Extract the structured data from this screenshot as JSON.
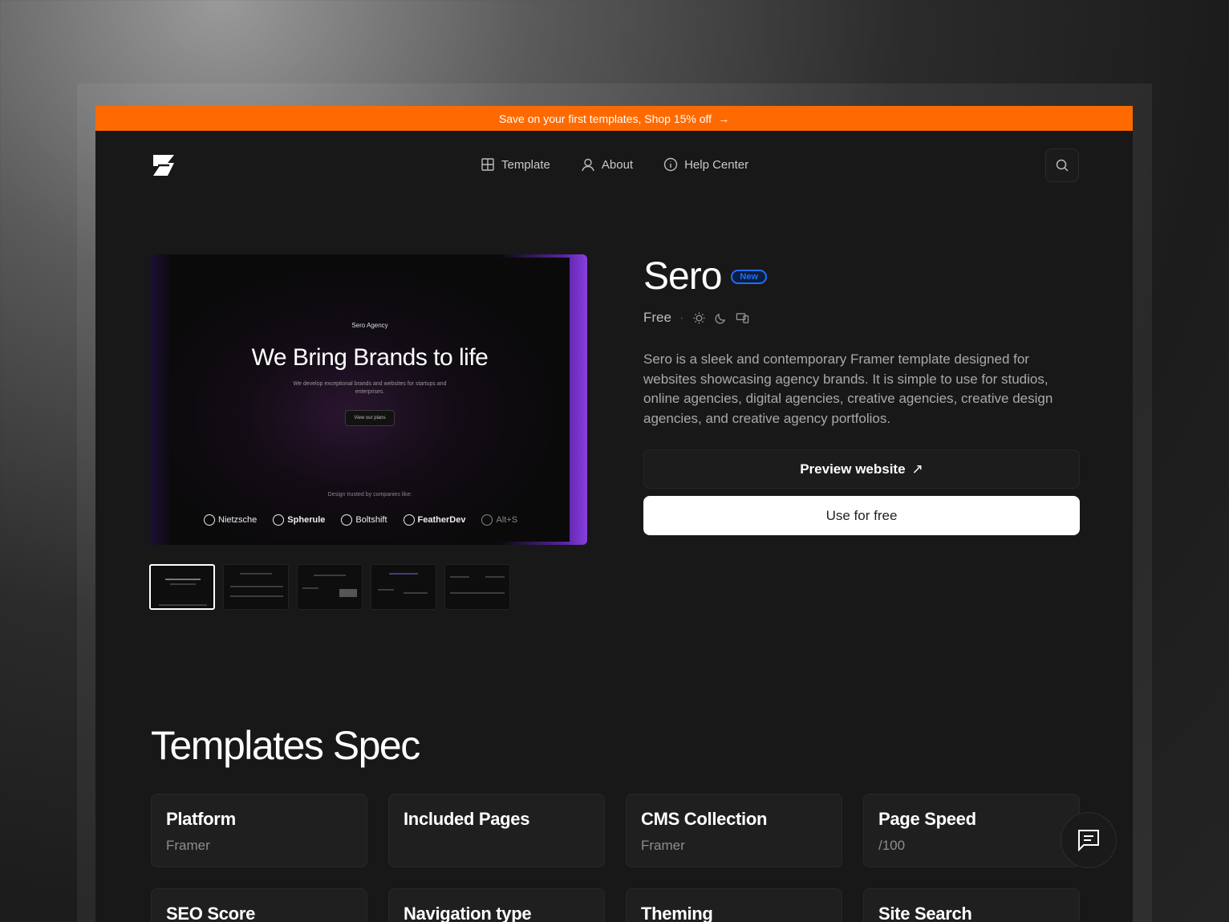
{
  "promo": {
    "text": "Save on your first templates, Shop 15% off",
    "arrow": "→"
  },
  "nav": {
    "items": [
      {
        "label": "Template",
        "icon": "grid-icon"
      },
      {
        "label": "About",
        "icon": "user-icon"
      },
      {
        "label": "Help Center",
        "icon": "info-icon"
      }
    ]
  },
  "preview": {
    "brand": "Sero Agency",
    "headline": "We Bring Brands to life",
    "subtext": "We develop exceptional brands and websites for startups and enterprises.",
    "button": "View our plans",
    "trusted": "Design trusted by companies like:",
    "logos": [
      "Nietzsche",
      "Spherule",
      "Boltshift",
      "FeatherDev",
      "Alt+S"
    ]
  },
  "product": {
    "title": "Sero",
    "badge": "New",
    "price": "Free",
    "separator": "·",
    "description": "Sero is a sleek and contemporary Framer template designed for websites showcasing agency brands. It is simple to use for studios, online agencies, digital agencies, creative agencies, creative design agencies, and creative agency portfolios.",
    "preview_button": "Preview website",
    "preview_arrow": "↗",
    "use_button": "Use for free"
  },
  "spec": {
    "title": "Templates Spec",
    "cards": [
      {
        "label": "Platform",
        "value": "Framer"
      },
      {
        "label": "Included Pages",
        "value": ""
      },
      {
        "label": "CMS Collection",
        "value": "Framer"
      },
      {
        "label": "Page Speed",
        "value": "/100"
      },
      {
        "label": "SEO Score",
        "value": ""
      },
      {
        "label": "Navigation type",
        "value": ""
      },
      {
        "label": "Theming",
        "value": ""
      },
      {
        "label": "Site Search",
        "value": ""
      }
    ]
  },
  "colors": {
    "promo_bg": "#ff6a00",
    "badge": "#1e6fff",
    "accent_purple": "#8a3ee0"
  }
}
